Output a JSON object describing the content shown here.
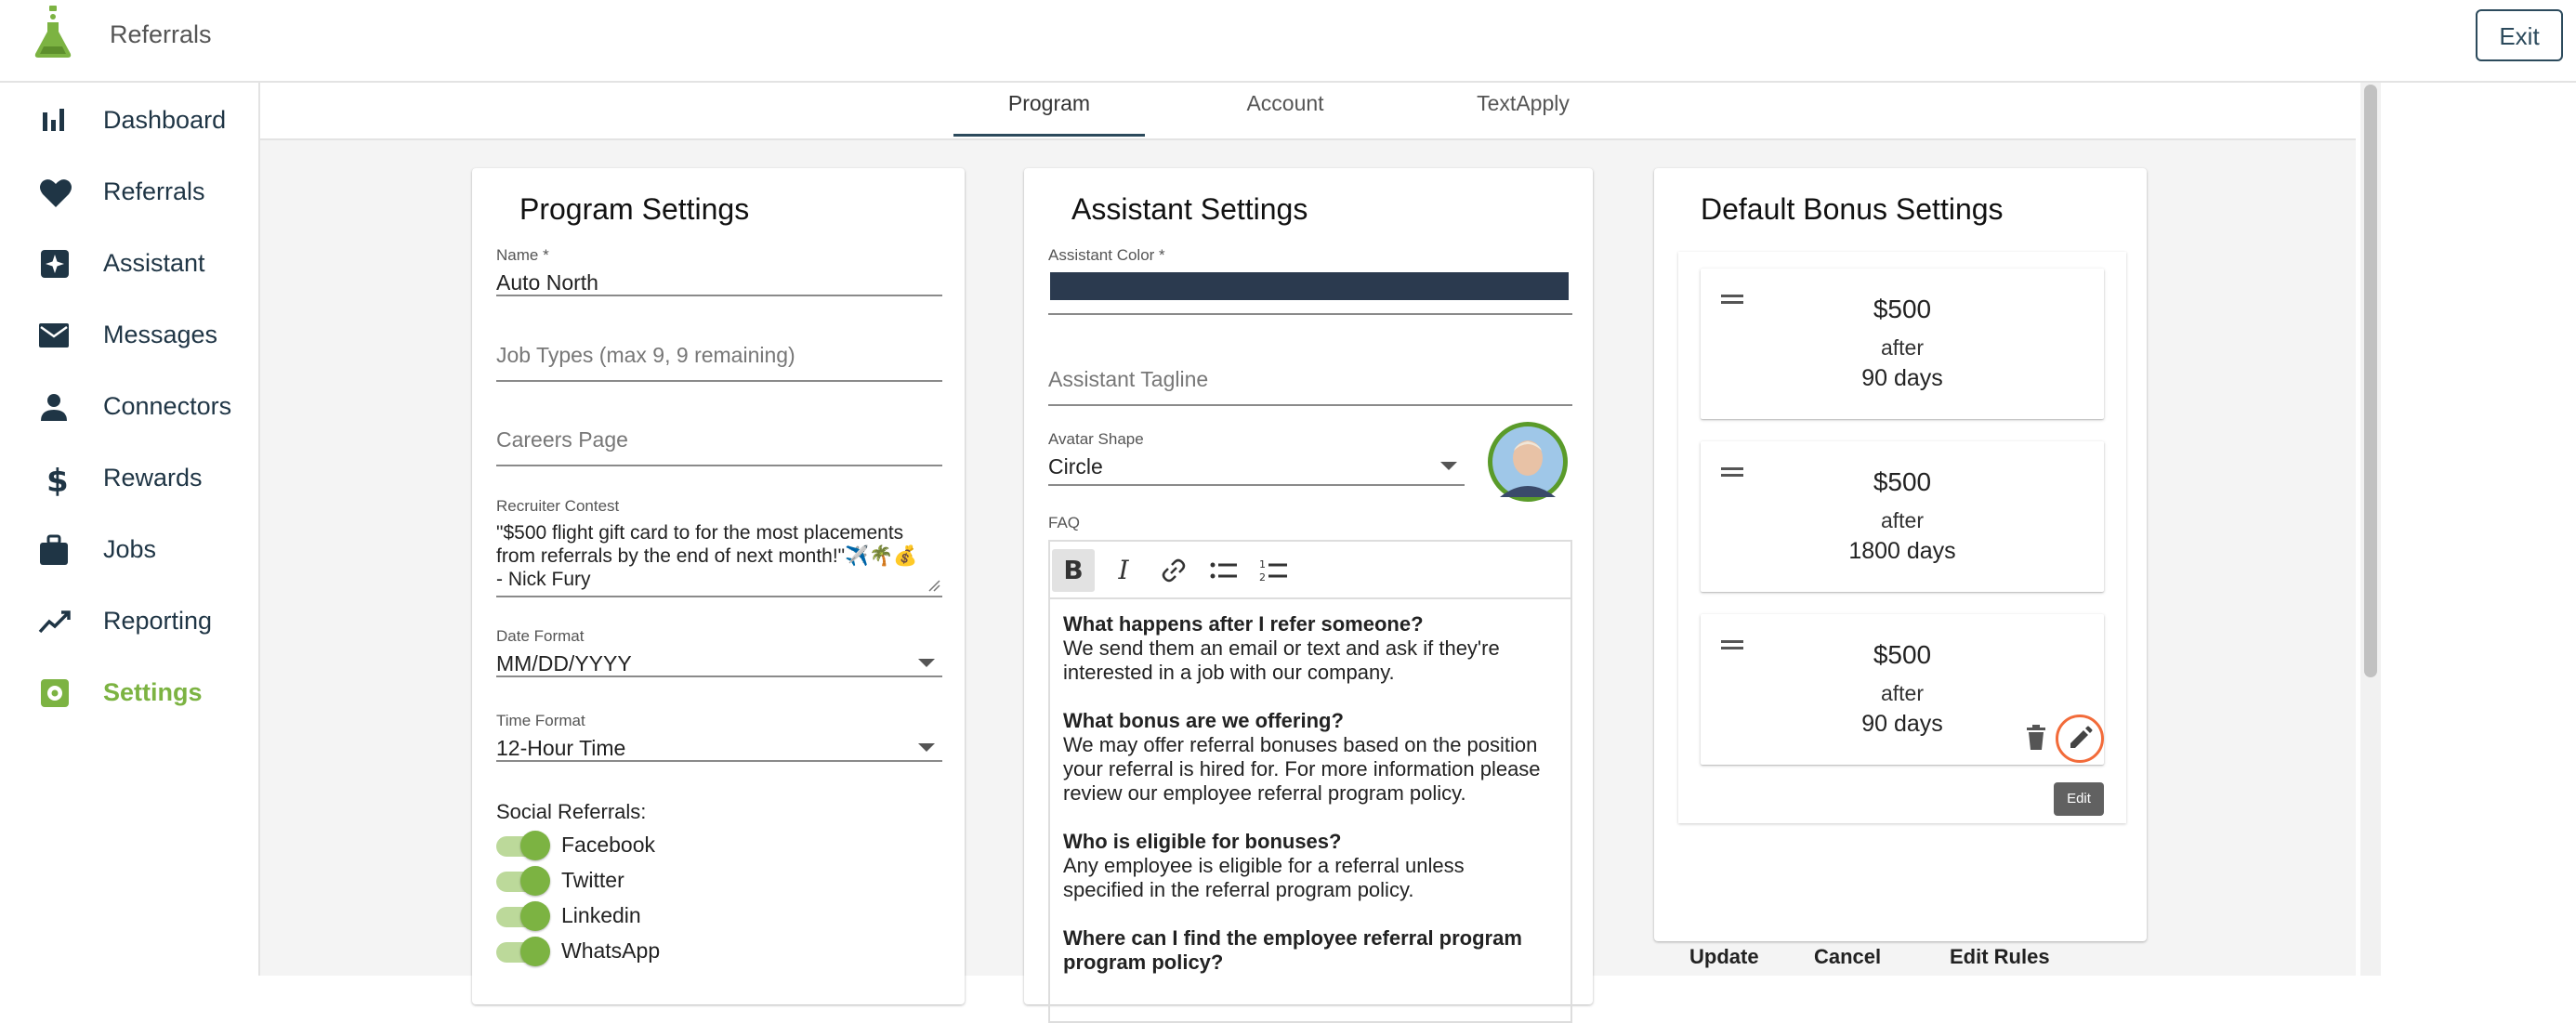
{
  "header": {
    "app_title": "Referrals",
    "exit_label": "Exit",
    "brand_color": "#7cb342"
  },
  "sidebar": {
    "items": [
      {
        "label": "Dashboard",
        "icon": "bar-chart-icon"
      },
      {
        "label": "Referrals",
        "icon": "heart-icon"
      },
      {
        "label": "Assistant",
        "icon": "sparkle-icon"
      },
      {
        "label": "Messages",
        "icon": "envelope-icon"
      },
      {
        "label": "Connectors",
        "icon": "person-icon"
      },
      {
        "label": "Rewards",
        "icon": "dollar-icon"
      },
      {
        "label": "Jobs",
        "icon": "briefcase-icon"
      },
      {
        "label": "Reporting",
        "icon": "trend-icon"
      },
      {
        "label": "Settings",
        "icon": "gear-icon",
        "active": true
      }
    ]
  },
  "tabs": [
    {
      "label": "Program",
      "active": true
    },
    {
      "label": "Account"
    },
    {
      "label": "TextApply"
    }
  ],
  "program_settings": {
    "title": "Program Settings",
    "name_label": "Name *",
    "name_value": "Auto North",
    "job_types_placeholder": "Job Types (max 9, 9 remaining)",
    "careers_placeholder": "Careers Page",
    "contest_label": "Recruiter Contest",
    "contest_line1": "\"$500 flight gift card to for the most placements",
    "contest_line2": "from referrals by the end of next month!\"✈️🌴💰",
    "contest_line3": "- Nick Fury",
    "date_format_label": "Date Format",
    "date_format_value": "MM/DD/YYYY",
    "time_format_label": "Time Format",
    "time_format_value": "12-Hour Time",
    "social_label": "Social Referrals:",
    "social": [
      {
        "label": "Facebook",
        "on": true
      },
      {
        "label": "Twitter",
        "on": true
      },
      {
        "label": "Linkedin",
        "on": true
      },
      {
        "label": "WhatsApp",
        "on": true
      }
    ]
  },
  "assistant_settings": {
    "title": "Assistant Settings",
    "color_label": "Assistant Color *",
    "color_value": "#2b3a4f",
    "tagline_placeholder": "Assistant Tagline",
    "avatar_shape_label": "Avatar Shape",
    "avatar_shape_value": "Circle",
    "faq_label": "FAQ",
    "faq": [
      {
        "q": "What happens after I refer someone?",
        "a1": "We send them an email or text and ask if they're",
        "a2": "interested in a job with our company.",
        "a3": ""
      },
      {
        "q": "What bonus are we offering?",
        "a1": "We may offer referral bonuses based on the position",
        "a2": "your referral is hired for. For more information please",
        "a3": "review our employee referral program policy."
      },
      {
        "q": "Who is eligible for bonuses?",
        "a1": "Any employee is eligible for a referral unless",
        "a2": "specified in the referral program policy.",
        "a3": ""
      },
      {
        "q": "Where can I find the employee referral program",
        "a1": "program policy?",
        "a2": "",
        "a3": ""
      }
    ]
  },
  "bonus_settings": {
    "title": "Default Bonus Settings",
    "items": [
      {
        "amount": "$500",
        "after": "after",
        "days": "90 days"
      },
      {
        "amount": "$500",
        "after": "after",
        "days": "1800 days"
      },
      {
        "amount": "$500",
        "after": "after",
        "days": "90 days"
      }
    ],
    "tooltip": "Edit",
    "update_label": "Update",
    "cancel_label": "Cancel",
    "edit_rules_label": "Edit Rules"
  }
}
